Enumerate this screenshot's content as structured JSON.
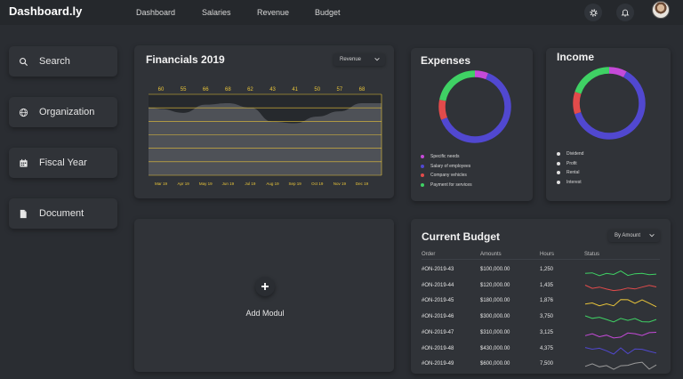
{
  "header": {
    "brand": "Dashboard.ly",
    "nav": [
      "Dashboard",
      "Salaries",
      "Revenue",
      "Budget"
    ],
    "icons": [
      "gear-icon",
      "bell-icon",
      "avatar"
    ]
  },
  "sidebar": {
    "items": [
      {
        "label": "Search",
        "icon": "search-icon"
      },
      {
        "label": "Organization",
        "icon": "globe-icon"
      },
      {
        "label": "Fiscal Year",
        "icon": "calendar-icon"
      },
      {
        "label": "Document",
        "icon": "document-icon"
      }
    ]
  },
  "financials": {
    "title": "Financials 2019",
    "dropdown": "Revenue",
    "accent": "#e8c43a",
    "chart_data": {
      "type": "area",
      "categories": [
        "Mar 19",
        "Apr 19",
        "May 19",
        "Jun 19",
        "Jul 19",
        "Aug 19",
        "Sep 19",
        "Oct 19",
        "Nov 19",
        "Dec 19"
      ],
      "values": [
        60,
        55,
        66,
        68,
        62,
        43,
        41,
        50,
        57,
        68
      ]
    }
  },
  "expenses": {
    "title": "Expenses",
    "chart_data": {
      "type": "pie",
      "labels": [
        "Specific needs",
        "Salary of employees",
        "Company vehicles",
        "Payment for services"
      ],
      "values": [
        6,
        63,
        9,
        22
      ],
      "colors": [
        "#c54ad8",
        "#5148d0",
        "#e24b4b",
        "#3fd164"
      ]
    }
  },
  "income": {
    "title": "Income",
    "chart_data": {
      "type": "pie",
      "labels": [
        "Dividend",
        "Profit",
        "Rental",
        "Interest"
      ],
      "values": [
        8,
        62,
        10,
        20
      ],
      "colors": [
        "#c54ad8",
        "#5148d0",
        "#e24b4b",
        "#3fd164"
      ]
    }
  },
  "budget": {
    "title": "Current Budget",
    "dropdown": "By Amount",
    "columns": [
      "Order",
      "Amounts",
      "Hours",
      "Status"
    ],
    "rows": [
      {
        "order": "#ON-2019-43",
        "amount": "$100,000.00",
        "hours": "1,250",
        "color": "#3fd164"
      },
      {
        "order": "#ON-2019-44",
        "amount": "$120,000.00",
        "hours": "1,435",
        "color": "#e24b4b"
      },
      {
        "order": "#ON-2019-45",
        "amount": "$180,000.00",
        "hours": "1,876",
        "color": "#e8c43a"
      },
      {
        "order": "#ON-2019-46",
        "amount": "$300,000.00",
        "hours": "3,750",
        "color": "#3fd164"
      },
      {
        "order": "#ON-2019-47",
        "amount": "$310,000.00",
        "hours": "3,125",
        "color": "#c54ad8"
      },
      {
        "order": "#ON-2019-48",
        "amount": "$430,000.00",
        "hours": "4,375",
        "color": "#5148d0"
      },
      {
        "order": "#ON-2019-49",
        "amount": "$600,000.00",
        "hours": "7,500",
        "color": "#9a9a9a"
      }
    ]
  },
  "add_module": {
    "label": "Add Modul"
  }
}
